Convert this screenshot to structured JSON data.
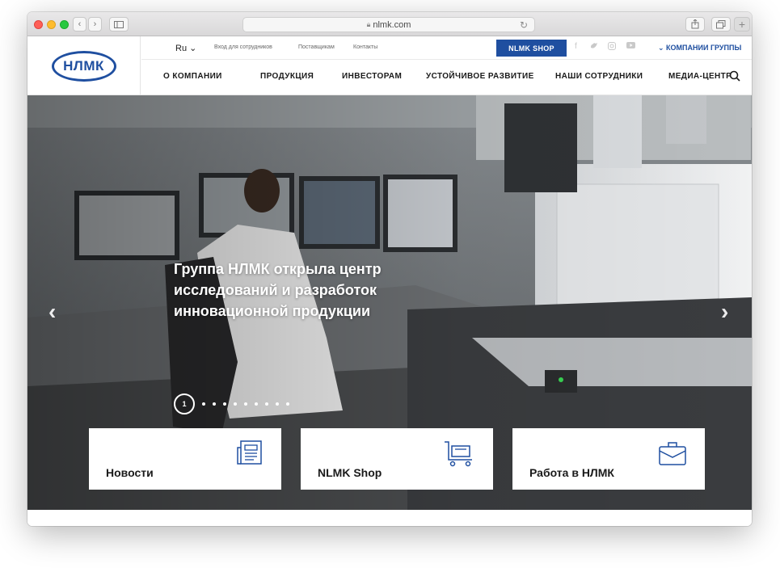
{
  "browser": {
    "url": "nlmk.com"
  },
  "header": {
    "logo_text": "НЛМК",
    "lang": "Ru ⌄",
    "top_links": [
      "Вход для сотрудников",
      "Поставщикам",
      "Контакты"
    ],
    "shop_button": "NLMK SHOP",
    "social_icons": [
      "facebook-icon",
      "twitter-icon",
      "instagram-icon",
      "youtube-icon"
    ],
    "group_link": "⌄ КОМПАНИИ ГРУППЫ",
    "nav": [
      "О КОМПАНИИ",
      "ПРОДУКЦИЯ",
      "ИНВЕСТОРАМ",
      "УСТОЙЧИВОЕ РАЗВИТИЕ",
      "НАШИ СОТРУДНИКИ",
      "МЕДИА-ЦЕНТР"
    ]
  },
  "hero": {
    "headline": "Группа НЛМК открыла центр исследований и разработок инновационной продукции",
    "slide_current": "1",
    "prev_arrow": "‹",
    "next_arrow": "›"
  },
  "cards": [
    {
      "label": "Новости",
      "icon": "newspaper-icon"
    },
    {
      "label": "NLMK Shop",
      "icon": "cart-icon"
    },
    {
      "label": "Работа в НЛМК",
      "icon": "briefcase-icon"
    }
  ],
  "colors": {
    "brand_blue": "#1f4fa0"
  }
}
